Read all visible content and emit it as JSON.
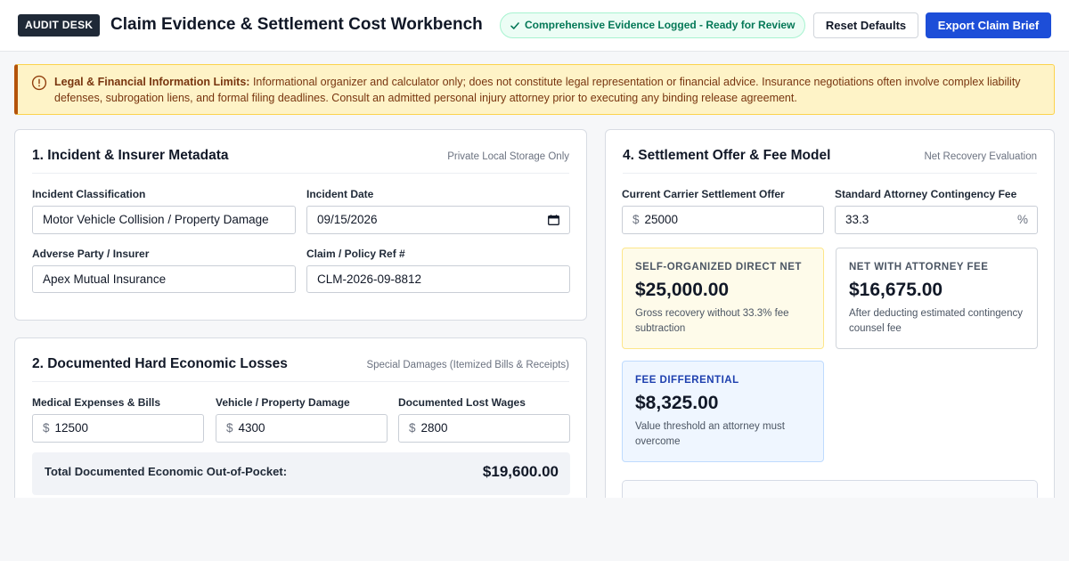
{
  "header": {
    "badge": "AUDIT DESK",
    "title": "Claim Evidence & Settlement Cost Workbench",
    "status": "Comprehensive Evidence Logged - Ready for Review",
    "reset_label": "Reset Defaults",
    "export_label": "Export Claim Brief"
  },
  "notice": {
    "heading": "Legal & Financial Information Limits:",
    "body": "Informational organizer and calculator only; does not constitute legal representation or financial advice. Insurance negotiations often involve complex liability defenses, subrogation liens, and formal filing deadlines. Consult an admitted personal injury attorney prior to executing any binding release agreement."
  },
  "incident": {
    "title": "1. Incident & Insurer Metadata",
    "meta": "Private Local Storage Only",
    "classification_label": "Incident Classification",
    "classification_value": "Motor Vehicle Collision / Property Damage",
    "date_label": "Incident Date",
    "date_value": "09/15/2026",
    "insurer_label": "Adverse Party / Insurer",
    "insurer_value": "Apex Mutual Insurance",
    "claim_label": "Claim / Policy Ref #",
    "claim_value": "CLM-2026-09-8812"
  },
  "losses": {
    "title": "2. Documented Hard Economic Losses",
    "meta": "Special Damages (Itemized Bills & Receipts)",
    "currency_symbol": "$",
    "medical_label": "Medical Expenses & Bills",
    "medical_value": "12500",
    "vehicle_label": "Vehicle / Property Damage",
    "vehicle_value": "4300",
    "wages_label": "Documented Lost Wages",
    "wages_value": "2800",
    "total_label": "Total Documented Economic Out-of-Pocket:",
    "total_value": "$19,600.00"
  },
  "settlement": {
    "title": "4. Settlement Offer & Fee Model",
    "meta": "Net Recovery Evaluation",
    "offer_label": "Current Carrier Settlement Offer",
    "currency_symbol": "$",
    "offer_value": "25000",
    "fee_label": "Standard Attorney Contingency Fee",
    "fee_value": "33.3",
    "fee_unit": "%",
    "direct_title": "SELF-ORGANIZED DIRECT NET",
    "direct_value": "$25,000.00",
    "direct_note": "Gross recovery without 33.3% fee subtraction",
    "attorney_title": "NET WITH ATTORNEY FEE",
    "attorney_value": "$16,675.00",
    "attorney_note": "After deducting estimated contingency counsel fee",
    "diff_title": "FEE DIFFERENTIAL",
    "diff_value": "$8,325.00",
    "diff_note": "Value threshold an attorney must overcome"
  }
}
